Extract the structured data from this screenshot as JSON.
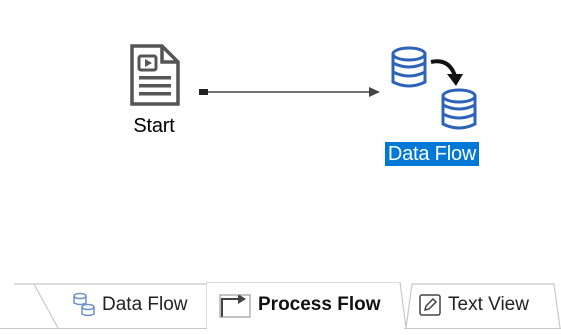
{
  "canvas": {
    "nodes": {
      "start": {
        "label": "Start",
        "icon": "document-icon",
        "selected": false
      },
      "dataflow": {
        "label": "Data Flow",
        "icon": "database-flow-icon",
        "selected": true
      }
    },
    "colors": {
      "selection": "#0078d7",
      "db_blue": "#2b63b8",
      "doc_gray": "#555555"
    }
  },
  "tabs": [
    {
      "label": "Data Flow",
      "icon": "data-flow-icon",
      "active": false
    },
    {
      "label": "Process Flow",
      "icon": "process-flow-icon",
      "active": true
    },
    {
      "label": "Text View",
      "icon": "pencil-icon",
      "active": false
    }
  ]
}
